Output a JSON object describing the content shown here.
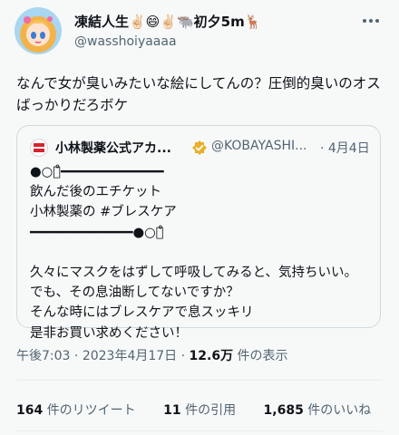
{
  "author": {
    "display_name": "凍結人生✌🏻😄✌🏻🐃初夕5m🦌",
    "handle": "@wasshoiyaaaa",
    "avatar_icon": "anime-girl-avatar"
  },
  "more_icon": "more-icon",
  "tweet": {
    "text": "なんで女が臭いみたいな絵にしてんの？圧倒的臭いのオスばっかりだろボケ"
  },
  "quoted_tweet": {
    "author_name": "小林製薬公式アカ...",
    "verified_icon": "verified-badge-icon",
    "handle": "@KOBAYASHI...",
    "date": "· 4月4日",
    "body": "●○。̊━━━━━━━━━━━━━\n飲んだ後のエチケット\n小林製薬の #ブレスケア\n━━━━━━━━━━━━━●○。̊\n\n久々にマスクをはずして呼吸してみると、気持ちいい。\nでも、その息油断してないですか？\nそんな時にはブレスケアで息スッキリ\n是非お買い求めください！"
  },
  "meta": {
    "time": "午後7:03",
    "date": "2023年4月17日",
    "views_count": "12.6万",
    "views_label": "件の表示"
  },
  "stats": {
    "retweets_count": "164",
    "retweets_label": "件のリツイート",
    "quotes_count": "11",
    "quotes_label": "件の引用",
    "likes_count": "1,685",
    "likes_label": "件のいいね"
  },
  "colors": {
    "background": "#f7f9f9",
    "text_primary": "#0f1419",
    "text_secondary": "#536471",
    "verified": "#e8b02a",
    "brand_red": "#d9232d"
  }
}
